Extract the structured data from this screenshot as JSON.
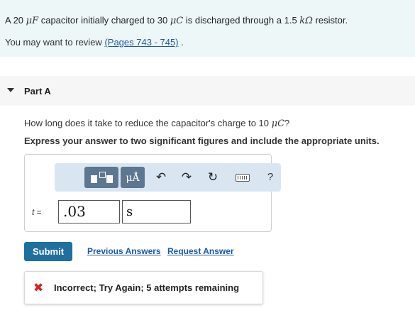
{
  "problem": {
    "text_1": "A 20 ",
    "unit_cap": "μF",
    "text_2": " capacitor initially charged to 30 ",
    "unit_charge": "μC",
    "text_3": " is discharged through a 1.5 ",
    "unit_res": "kΩ",
    "text_4": " resistor.",
    "review_prefix": "You may want to review ",
    "review_link": "(Pages 743 - 745)",
    "review_suffix": " ."
  },
  "part": {
    "title": "Part A",
    "question_text": "How long does it take to reduce the capacitor's charge to 10 ",
    "question_unit": "μC",
    "question_end": "?",
    "instruction": "Express your answer to two significant figures and include the appropriate units."
  },
  "toolbar": {
    "units_label": "μÅ",
    "undo_icon": "↶",
    "redo_icon": "↷",
    "reset_icon": "↻",
    "help_label": "?"
  },
  "answer": {
    "variable": "t",
    "equals": " =",
    "value": ".03",
    "unit": "s"
  },
  "actions": {
    "submit": "Submit",
    "previous_answers": "Previous Answers",
    "request_answer": "Request Answer"
  },
  "feedback": {
    "icon": "✖",
    "message": "Incorrect; Try Again; 5 attempts remaining"
  },
  "colors": {
    "problem_bg": "#eef7f8",
    "toolbar_bg": "#d9e6f2",
    "submit_bg": "#1f6fa0",
    "error_red": "#d3222a",
    "link": "#1a5aa6"
  }
}
